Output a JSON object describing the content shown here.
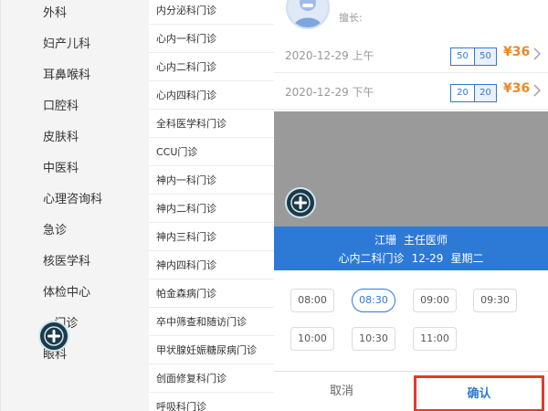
{
  "departments": [
    "外科",
    "妇产儿科",
    "耳鼻喉科",
    "口腔科",
    "皮肤科",
    "中医科",
    "心理咨询科",
    "急诊",
    "核医学科",
    "体检中心",
    "...门诊",
    "眼科"
  ],
  "clinics": [
    "内分泌科门诊",
    "心内一科门诊",
    "心内二科门诊",
    "心内四科门诊",
    "全科医学科门诊",
    "CCU门诊",
    "神内一科门诊",
    "神内二科门诊",
    "神内三科门诊",
    "神内四科门诊",
    "帕金森病门诊",
    "卒中筛查和随访门诊",
    "甲状腺妊娠糖尿病门诊",
    "创面修复科门诊",
    "呼吸科门诊"
  ],
  "doctor": {
    "specialty_label": "擅长:"
  },
  "slots": [
    {
      "date": "2020-12-29 上午",
      "count_left": "50",
      "count_right": "50",
      "price": "¥36"
    },
    {
      "date": "2020-12-29 下午",
      "count_left": "20",
      "count_right": "20",
      "price": "¥36"
    }
  ],
  "selection": {
    "doctor_name": "江珊",
    "doctor_title": "主任医师",
    "clinic": "心内二科门诊",
    "date": "12-29",
    "weekday": "星期二"
  },
  "times": [
    "08:00",
    "08:30",
    "09:00",
    "09:30",
    "10:00",
    "10:30",
    "11:00"
  ],
  "selected_time": "08:30",
  "actions": {
    "cancel": "取消",
    "confirm": "确认"
  },
  "colors": {
    "accent": "#2d7ad6",
    "price": "#e8892a",
    "highlight": "#e03a2f",
    "overlay": "#9a9a9a"
  },
  "icons": {
    "fab": "plus-icon",
    "chevron": "chevron-right-icon",
    "avatar": "doctor-avatar-icon"
  }
}
